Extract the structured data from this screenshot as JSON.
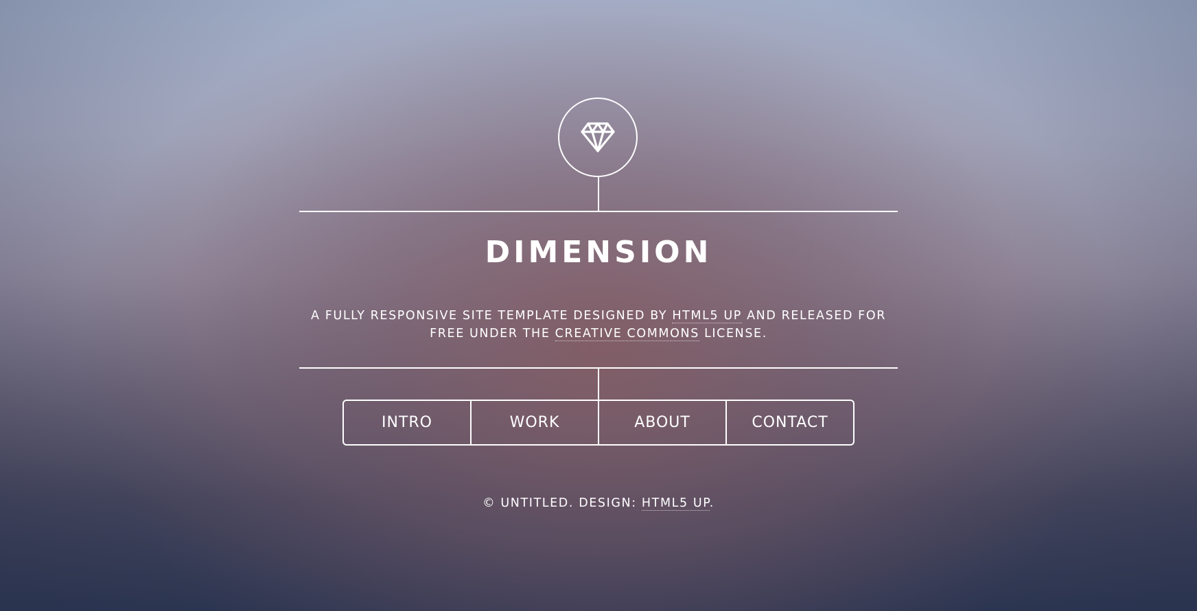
{
  "header": {
    "logo_icon": "diamond-icon",
    "title": "DIMENSION",
    "intro": {
      "text_before": "A fully responsive site template designed by ",
      "link1": "HTML5 UP",
      "text_middle": " and released for free under the ",
      "link2": "Creative Commons",
      "text_after": " license."
    }
  },
  "nav": {
    "items": [
      {
        "label": "Intro"
      },
      {
        "label": "Work"
      },
      {
        "label": "About"
      },
      {
        "label": "Contact"
      }
    ]
  },
  "footer": {
    "copyright": "© Untitled. Design: ",
    "link": "HTML5 UP",
    "suffix": "."
  },
  "colors": {
    "foreground": "#ffffff",
    "background_top": "#a9b6cf",
    "background_center": "#825c64",
    "background_bottom": "#313a55"
  }
}
